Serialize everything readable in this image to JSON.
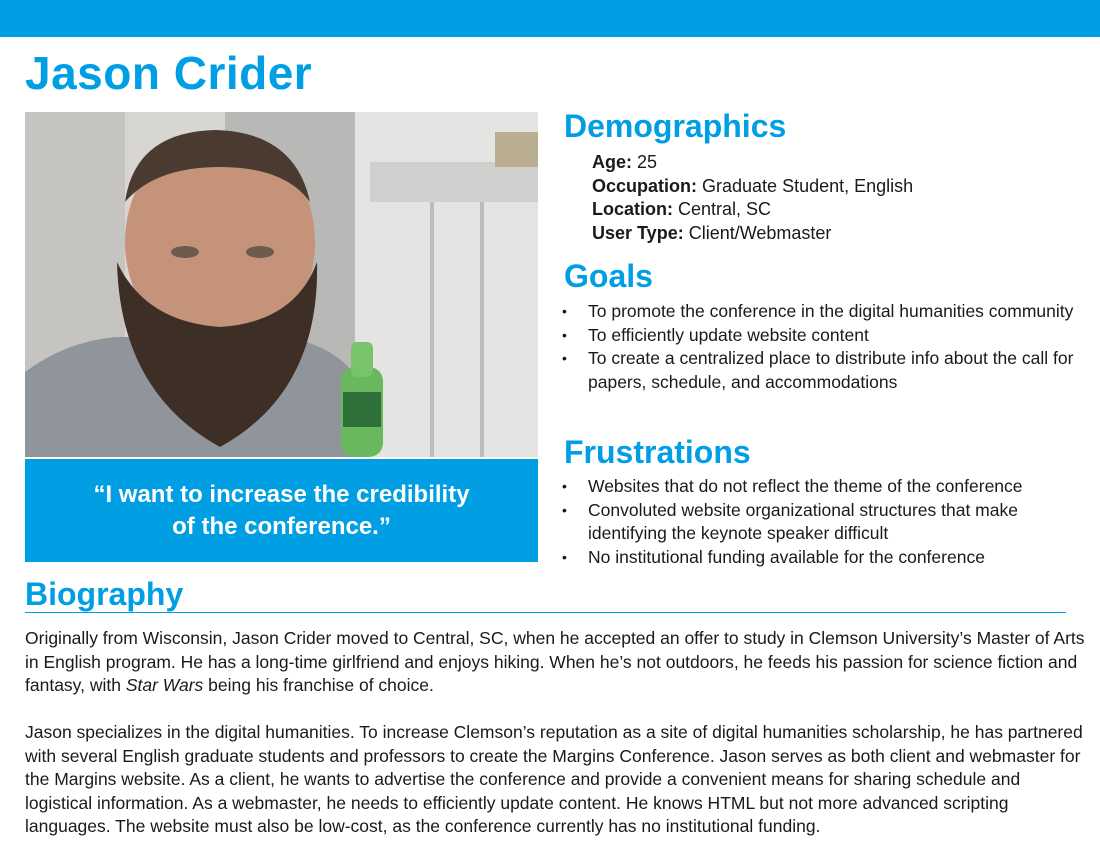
{
  "persona": {
    "name": "Jason Crider",
    "quote_line1": "“I want to increase the credibility",
    "quote_line2": "of the conference.”"
  },
  "demographics": {
    "heading": "Demographics",
    "items": [
      {
        "label": "Age:",
        "value": " 25"
      },
      {
        "label": "Occupation:",
        "value": " Graduate Student, English"
      },
      {
        "label": "Location:",
        "value": " Central, SC"
      },
      {
        "label": "User Type:",
        "value": " Client/Webmaster"
      }
    ]
  },
  "goals": {
    "heading": "Goals",
    "items": [
      "To promote the conference in the digital humanities community",
      "To efficiently update website content",
      "To create a centralized place to distribute info about the call for papers, schedule, and accommodations"
    ]
  },
  "frustrations": {
    "heading": "Frustrations",
    "items": [
      "Websites that do not reflect the theme of the conference",
      "Convoluted website organizational structures that make identifying the keynote speaker difficult",
      "No institutional funding available for the conference"
    ]
  },
  "biography": {
    "heading": "Biography",
    "p1_before": "Originally from Wisconsin, Jason Crider moved to Central, SC, when he accepted an offer to study in Clemson University’s Master of Arts in English program. He has a long-time girlfriend and enjoys hiking. When he’s not outdoors, he feeds his passion for science fiction and fantasy, with ",
    "p1_italic": "Star Wars",
    "p1_after": " being his franchise of choice.",
    "p2": "Jason specializes in the digital humanities. To increase Clemson’s reputation as a site of digital humanities scholarship, he has partnered with several English graduate students and professors to create the Margins Conference. Jason serves as both client and webmaster for the Margins website. As a client, he wants to advertise the conference and provide a convenient means for sharing schedule and logistical information. As a webmaster, he needs to efficiently update content. He knows HTML but not more advanced scripting languages. The website must also be low-cost, as the conference currently has no institutional funding."
  },
  "colors": {
    "accent": "#009ee3",
    "text": "#1a1a1a"
  }
}
